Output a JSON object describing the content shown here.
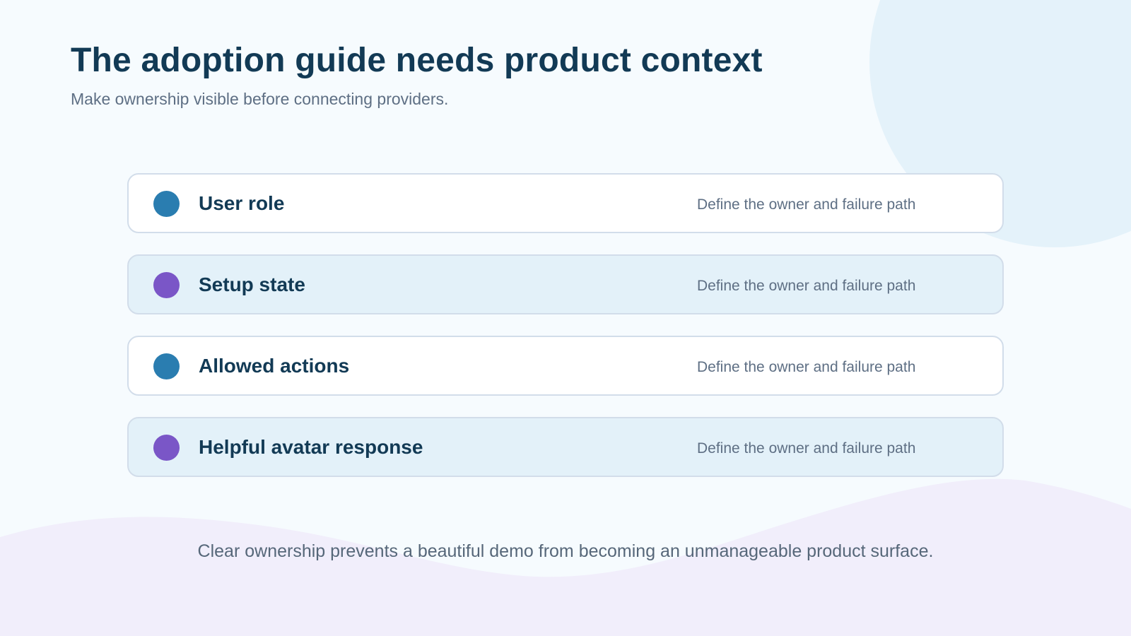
{
  "title": "The adoption guide needs product context",
  "subtitle": "Make ownership visible before connecting providers.",
  "rows": [
    {
      "label": "User role",
      "description": "Define the owner and failure path",
      "dot_color": "#2a7db0",
      "background": "#ffffff"
    },
    {
      "label": "Setup state",
      "description": "Define the owner and failure path",
      "dot_color": "#7a56c7",
      "background": "#e3f1f9"
    },
    {
      "label": "Allowed actions",
      "description": "Define the owner and failure path",
      "dot_color": "#2a7db0",
      "background": "#ffffff"
    },
    {
      "label": "Helpful avatar response",
      "description": "Define the owner and failure path",
      "dot_color": "#7a56c7",
      "background": "#e3f1f9"
    }
  ],
  "footer": "Clear ownership prevents a beautiful demo from becoming an unmanageable product surface.",
  "colors": {
    "background": "#f6fbfe",
    "heading": "#123a55",
    "muted_text": "#5e6f84",
    "blue_accent": "#2a7db0",
    "purple_accent": "#7a56c7",
    "top_right_blob": "#e4f2fa",
    "bottom_wave": "#f1eefb"
  }
}
